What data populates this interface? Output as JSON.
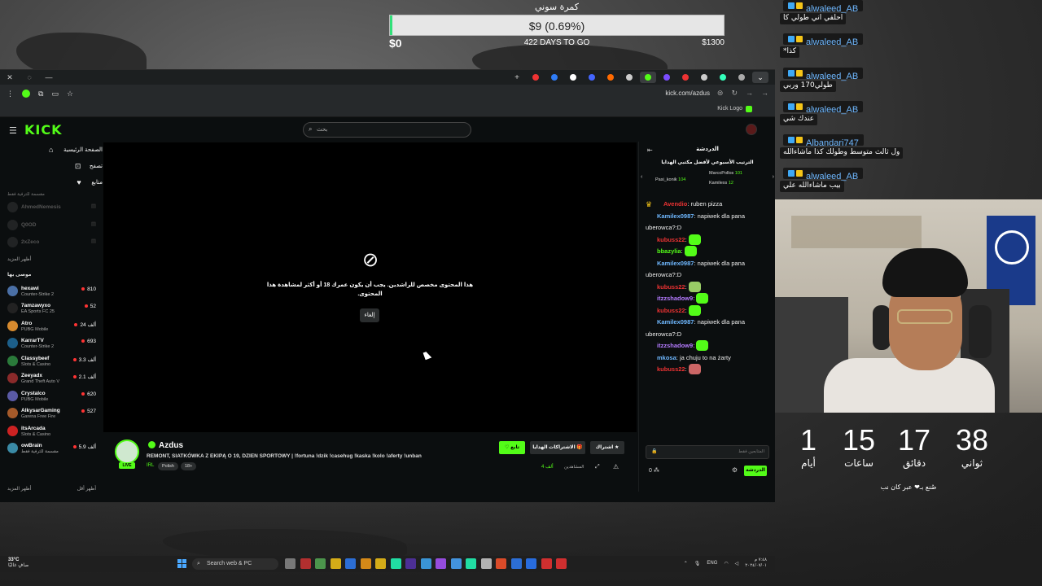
{
  "goal": {
    "title": "كمرة سوني",
    "amount_label": "$9 (0.69%)",
    "progress": 0.0069,
    "min_label": "$0",
    "days_label": "422 DAYS TO GO",
    "max_label": "$1300"
  },
  "browser": {
    "url": "kick.com/azdus",
    "bookmark": "Kick Logo",
    "tab_colors": [
      "#e33",
      "#2f7cf6",
      "#fff",
      "#4466ff",
      "#ff6a00",
      "#ccc",
      "#53fc18",
      "#7b4dff",
      "#e33",
      "#ccc",
      "#3fb",
      "#aaa"
    ]
  },
  "kick": {
    "logo": "KICK",
    "search_placeholder": "بحث",
    "sidebar": {
      "main": [
        {
          "label": "الصفحة الرئيسية",
          "icon": "⌂"
        },
        {
          "label": "تصفح",
          "icon": "⊡"
        },
        {
          "label": "متابع",
          "icon": "♥"
        }
      ],
      "followed_hidden": "مقسمة للترفية فقط",
      "followed": [
        {
          "name": "AhmedNemesis",
          "color": "#555"
        },
        {
          "name": "Q0OD",
          "color": "#555"
        },
        {
          "name": "2xZeco",
          "color": "#555"
        }
      ],
      "show_more": "أظهر المزيد",
      "recommended_title": "موصى بها",
      "recommended": [
        {
          "name": "hexawi",
          "game": "Counter-Strike 2",
          "viewers": "810",
          "color": "#4a6fa5"
        },
        {
          "name": "7amzawyxo",
          "game": "EA Sports FC 25",
          "viewers": "52",
          "color": "#222"
        },
        {
          "name": "Atro",
          "game": "PUBG Mobile",
          "viewers": "24 ألف",
          "color": "#d68a2e"
        },
        {
          "name": "KarrarTV",
          "game": "Counter-Strike 2",
          "viewers": "693",
          "color": "#1c5f8a"
        },
        {
          "name": "Classybeef",
          "game": "Slots & Casino",
          "viewers": "3.3 ألف",
          "color": "#2a7a3a"
        },
        {
          "name": "Zeeyadx",
          "game": "Grand Theft Auto V",
          "viewers": "2.1 ألف",
          "color": "#8a2a2a"
        },
        {
          "name": "Crystalco",
          "game": "PUBG Mobile",
          "viewers": "620",
          "color": "#5a5aa5"
        },
        {
          "name": "AlkysarGaming",
          "game": "Garena Free Fire",
          "viewers": "527",
          "color": "#a55a2a"
        },
        {
          "name": "itsArcada",
          "game": "Slots & Casino",
          "viewers": "",
          "color": "#c22"
        },
        {
          "name": "owBrain",
          "game": "مقسمة للترفية فقط",
          "viewers": "5.9 ألف",
          "color": "#3a8aa5"
        }
      ],
      "show_more_2": "أظهر المزيد",
      "show_less": "أظهر أقل"
    },
    "player": {
      "message": "هذا المحتوى مخصص للراشدين. يجب أن يكون عمرك 18 أو أكثر لمشاهدة هذا المحتوى.",
      "cancel": "إلغاء"
    },
    "stream": {
      "name": "Azdus",
      "live": "LIVE",
      "title": "REMONT, SIATKÓWKA Z EKIPĄ O 19, DZIEN SPORTOWY | !fortuna !dzik !casehug !kaska !kolo !aferty !unban",
      "category": "IRL",
      "tags": [
        "Polish",
        "18+"
      ],
      "follow": "تابع",
      "gift": "الاشتراكات الهدايا",
      "subscribe": "اشتراك",
      "viewers_count": "4 ألف",
      "viewers_label": "المشاهدين"
    },
    "chat": {
      "header": "الدردشة",
      "leaderboard_title": "الترتيب الأسبوعي لأفضل مكتبي الهدايا",
      "leaderboard": [
        {
          "name": "Pasi_konik",
          "score": "104"
        },
        {
          "name": "MarcoPollos",
          "score": "101"
        },
        {
          "name": "Kamilexs",
          "score": "12"
        }
      ],
      "messages": [
        {
          "user": "Avendio",
          "color": "#e33",
          "text": "ruben pizza",
          "emote": ""
        },
        {
          "user": "Kamilex0987",
          "color": "#6fb8ff",
          "text": "napiwek dla pana uberowca?:D",
          "emote": ""
        },
        {
          "user": "kubuss22",
          "color": "#e33",
          "text": "",
          "emote": "#53fc18"
        },
        {
          "user": "bbazylia",
          "color": "#53fc18",
          "text": "",
          "emote": "#53fc18"
        },
        {
          "user": "Kamilex0987",
          "color": "#6fb8ff",
          "text": "napiwek dla pana uberowca?:D",
          "emote": ""
        },
        {
          "user": "kubuss22",
          "color": "#e33",
          "text": "",
          "emote": "#9c6"
        },
        {
          "user": "itzzshadow9",
          "color": "#b57bff",
          "text": "",
          "emote": "#53fc18"
        },
        {
          "user": "kubuss22",
          "color": "#e33",
          "text": "",
          "emote": "#53fc18"
        },
        {
          "user": "Kamilex0987",
          "color": "#6fb8ff",
          "text": "napiwek dla pana uberowca?:D",
          "emote": ""
        },
        {
          "user": "itzzshadow9",
          "color": "#b57bff",
          "text": "",
          "emote": "#53fc18"
        },
        {
          "user": "mkosa",
          "color": "#6fb8ff",
          "text": "ja chuju to na żarty",
          "emote": ""
        },
        {
          "user": "kubuss22",
          "color": "#e33",
          "text": "",
          "emote": "#c66"
        }
      ],
      "input_placeholder": "المتابعين فقط",
      "send": "الدردشة",
      "points": "0"
    }
  },
  "taskbar": {
    "temp": "33°C",
    "weather": "صافٍ غالبًا",
    "search": "Search web & PC",
    "lang": "ENG",
    "time": "٧:٤٨ م",
    "date": "٢٠٢٤/٠٧/٠١",
    "app_colors": [
      "#888",
      "#c33",
      "#5a5",
      "#f5c518",
      "#2f7cf6",
      "#f59c18",
      "#f5c518",
      "#2fb",
      "#53a",
      "#3fa9f5",
      "#a5f",
      "#4aa8ff",
      "#2fb",
      "#ccc",
      "#fb542b",
      "#2f7cf6",
      "#2a7aff",
      "#e33",
      "#e33"
    ]
  },
  "overlay_chat": [
    {
      "user": "alwaleed_AB",
      "text": "احلفي اني طولي كا"
    },
    {
      "user": "alwaleed_AB",
      "text": "كذا*"
    },
    {
      "user": "alwaleed_AB",
      "text": "طولي170 وربي"
    },
    {
      "user": "alwaleed_AB",
      "text": "عندك شي"
    },
    {
      "user": "Albandari747",
      "text": "ول ثالث متوسط وطولك كذا ماشاءالله"
    },
    {
      "user": "alwaleed_AB",
      "text": "بيب ماشاءالله علي"
    }
  ],
  "countdown": [
    {
      "value": "1",
      "label": "أيام"
    },
    {
      "value": "15",
      "label": "ساعات"
    },
    {
      "value": "17",
      "label": "دقائق"
    },
    {
      "value": "38",
      "label": "ثواني"
    }
  ],
  "countdown_footer": "صُنع بـ❤ عبر كان نب"
}
